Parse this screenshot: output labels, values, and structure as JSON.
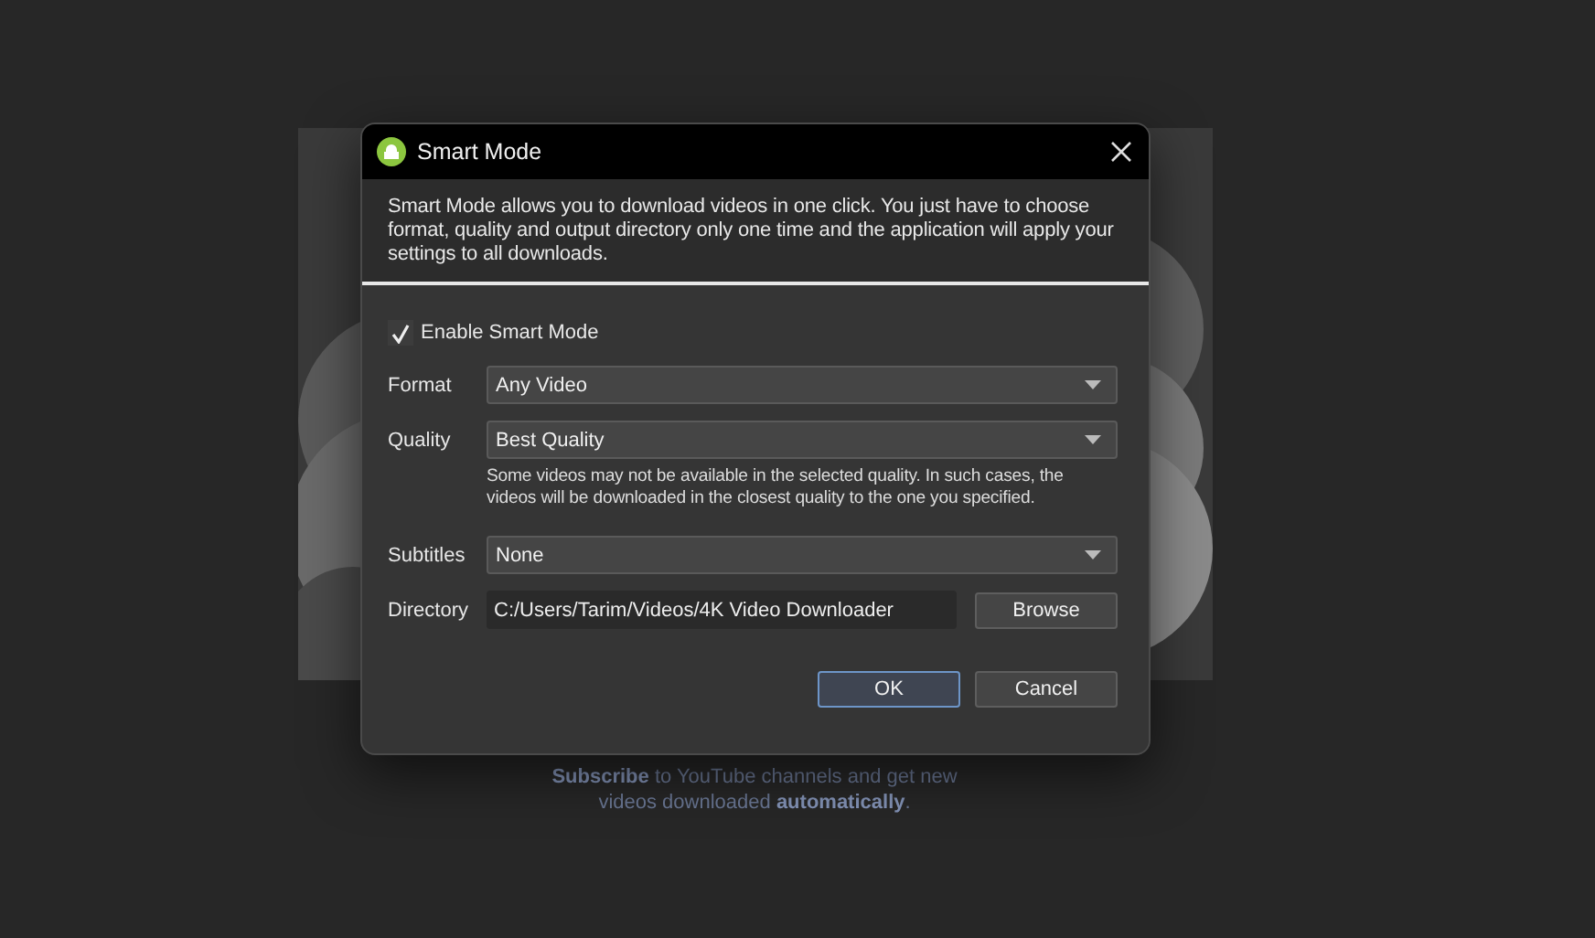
{
  "window": {
    "title": "Smart Mode"
  },
  "description": "Smart Mode allows you to download videos in one click. You just have to choose format, quality and output directory only one time and the application will apply your settings to all downloads.",
  "enable_smart_mode": {
    "label": "Enable Smart Mode",
    "checked": true
  },
  "fields": [
    {
      "kind": "dropdown",
      "label": "Format",
      "value": "Any Video"
    },
    {
      "kind": "dropdown",
      "label": "Quality",
      "value": "Best Quality",
      "note": "Some videos may not be available in the selected quality. In such cases, the videos will be downloaded in the closest quality to the one you specified."
    },
    {
      "kind": "dropdown",
      "label": "Subtitles",
      "value": "None"
    },
    {
      "kind": "path",
      "label": "Directory",
      "value": "C:/Users/Tarim/Videos/4K Video Downloader",
      "button": "Browse"
    }
  ],
  "buttons": [
    {
      "label": "OK",
      "default": true
    },
    {
      "label": "Cancel",
      "default": false
    }
  ],
  "background": {
    "promo_text": "**Subscribe** to YouTube channels and get new videos downloaded **automatically**."
  }
}
